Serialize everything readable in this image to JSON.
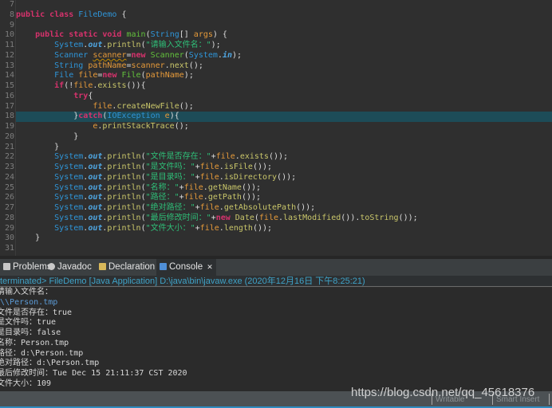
{
  "editor": {
    "lines": [
      {
        "num": "7",
        "tokens": []
      },
      {
        "num": "8",
        "tokens": [
          {
            "t": "k",
            "c": "public class "
          },
          {
            "t": "c",
            "c": "FileDemo"
          },
          {
            "t": "p",
            "c": " {"
          }
        ]
      },
      {
        "num": "9",
        "tokens": []
      },
      {
        "num": "10",
        "tokens": [
          {
            "t": "k",
            "c": "    public static void "
          },
          {
            "t": "fn",
            "c": "main"
          },
          {
            "t": "p",
            "c": "("
          },
          {
            "t": "c",
            "c": "String"
          },
          {
            "t": "p",
            "c": "[] "
          },
          {
            "t": "v",
            "c": "args"
          },
          {
            "t": "p",
            "c": ") {"
          }
        ]
      },
      {
        "num": "11",
        "tokens": [
          {
            "t": "c",
            "c": "        System"
          },
          {
            "t": "p",
            "c": "."
          },
          {
            "t": "f",
            "c": "out"
          },
          {
            "t": "p",
            "c": "."
          },
          {
            "t": "m",
            "c": "println"
          },
          {
            "t": "p",
            "c": "("
          },
          {
            "t": "s",
            "c": "\"请输入文件名：\""
          },
          {
            "t": "p",
            "c": ");"
          }
        ]
      },
      {
        "num": "12",
        "tokens": [
          {
            "t": "c",
            "c": "        Scanner "
          },
          {
            "t": "u",
            "c": "scanner"
          },
          {
            "t": "p",
            "c": "="
          },
          {
            "t": "k",
            "c": "new "
          },
          {
            "t": "fn",
            "c": "Scanner"
          },
          {
            "t": "p",
            "c": "("
          },
          {
            "t": "c",
            "c": "System"
          },
          {
            "t": "p",
            "c": "."
          },
          {
            "t": "f",
            "c": "in"
          },
          {
            "t": "p",
            "c": ");"
          }
        ]
      },
      {
        "num": "13",
        "tokens": [
          {
            "t": "c",
            "c": "        String "
          },
          {
            "t": "v",
            "c": "pathName"
          },
          {
            "t": "p",
            "c": "="
          },
          {
            "t": "v",
            "c": "scanner"
          },
          {
            "t": "p",
            "c": "."
          },
          {
            "t": "m",
            "c": "next"
          },
          {
            "t": "p",
            "c": "();"
          }
        ]
      },
      {
        "num": "14",
        "tokens": [
          {
            "t": "c",
            "c": "        File "
          },
          {
            "t": "v",
            "c": "file"
          },
          {
            "t": "p",
            "c": "="
          },
          {
            "t": "k",
            "c": "new "
          },
          {
            "t": "fn",
            "c": "File"
          },
          {
            "t": "p",
            "c": "("
          },
          {
            "t": "v",
            "c": "pathName"
          },
          {
            "t": "p",
            "c": ");"
          }
        ]
      },
      {
        "num": "15",
        "tokens": [
          {
            "t": "k",
            "c": "        if"
          },
          {
            "t": "p",
            "c": "(!"
          },
          {
            "t": "v",
            "c": "file"
          },
          {
            "t": "p",
            "c": "."
          },
          {
            "t": "m",
            "c": "exists"
          },
          {
            "t": "p",
            "c": "()){"
          }
        ]
      },
      {
        "num": "16",
        "tokens": [
          {
            "t": "k",
            "c": "            try"
          },
          {
            "t": "p",
            "c": "{"
          }
        ]
      },
      {
        "num": "17",
        "tokens": [
          {
            "t": "v",
            "c": "                file"
          },
          {
            "t": "p",
            "c": "."
          },
          {
            "t": "m",
            "c": "createNewFile"
          },
          {
            "t": "p",
            "c": "();"
          }
        ]
      },
      {
        "num": "18",
        "hl": true,
        "tokens": [
          {
            "t": "p",
            "c": "            }"
          },
          {
            "t": "k",
            "c": "catch"
          },
          {
            "t": "p",
            "c": "("
          },
          {
            "t": "c",
            "c": "IOException "
          },
          {
            "t": "v",
            "c": "e"
          },
          {
            "t": "p",
            "c": "){"
          }
        ]
      },
      {
        "num": "19",
        "tokens": [
          {
            "t": "v",
            "c": "                e"
          },
          {
            "t": "p",
            "c": "."
          },
          {
            "t": "m",
            "c": "printStackTrace"
          },
          {
            "t": "p",
            "c": "();"
          }
        ]
      },
      {
        "num": "20",
        "tokens": [
          {
            "t": "p",
            "c": "            }"
          }
        ]
      },
      {
        "num": "21",
        "tokens": [
          {
            "t": "p",
            "c": "        }"
          }
        ]
      },
      {
        "num": "22",
        "tokens": [
          {
            "t": "c",
            "c": "        System"
          },
          {
            "t": "p",
            "c": "."
          },
          {
            "t": "f",
            "c": "out"
          },
          {
            "t": "p",
            "c": "."
          },
          {
            "t": "m",
            "c": "println"
          },
          {
            "t": "p",
            "c": "("
          },
          {
            "t": "s",
            "c": "\"文件是否存在：\""
          },
          {
            "t": "p",
            "c": "+"
          },
          {
            "t": "v",
            "c": "file"
          },
          {
            "t": "p",
            "c": "."
          },
          {
            "t": "m",
            "c": "exists"
          },
          {
            "t": "p",
            "c": "());"
          }
        ]
      },
      {
        "num": "23",
        "tokens": [
          {
            "t": "c",
            "c": "        System"
          },
          {
            "t": "p",
            "c": "."
          },
          {
            "t": "f",
            "c": "out"
          },
          {
            "t": "p",
            "c": "."
          },
          {
            "t": "m",
            "c": "println"
          },
          {
            "t": "p",
            "c": "("
          },
          {
            "t": "s",
            "c": "\"是文件吗：\""
          },
          {
            "t": "p",
            "c": "+"
          },
          {
            "t": "v",
            "c": "file"
          },
          {
            "t": "p",
            "c": "."
          },
          {
            "t": "m",
            "c": "isFile"
          },
          {
            "t": "p",
            "c": "());"
          }
        ]
      },
      {
        "num": "24",
        "tokens": [
          {
            "t": "c",
            "c": "        System"
          },
          {
            "t": "p",
            "c": "."
          },
          {
            "t": "f",
            "c": "out"
          },
          {
            "t": "p",
            "c": "."
          },
          {
            "t": "m",
            "c": "println"
          },
          {
            "t": "p",
            "c": "("
          },
          {
            "t": "s",
            "c": "\"是目录吗：\""
          },
          {
            "t": "p",
            "c": "+"
          },
          {
            "t": "v",
            "c": "file"
          },
          {
            "t": "p",
            "c": "."
          },
          {
            "t": "m",
            "c": "isDirectory"
          },
          {
            "t": "p",
            "c": "());"
          }
        ]
      },
      {
        "num": "25",
        "tokens": [
          {
            "t": "c",
            "c": "        System"
          },
          {
            "t": "p",
            "c": "."
          },
          {
            "t": "f",
            "c": "out"
          },
          {
            "t": "p",
            "c": "."
          },
          {
            "t": "m",
            "c": "println"
          },
          {
            "t": "p",
            "c": "("
          },
          {
            "t": "s",
            "c": "\"名称：\""
          },
          {
            "t": "p",
            "c": "+"
          },
          {
            "t": "v",
            "c": "file"
          },
          {
            "t": "p",
            "c": "."
          },
          {
            "t": "m",
            "c": "getName"
          },
          {
            "t": "p",
            "c": "());"
          }
        ]
      },
      {
        "num": "26",
        "tokens": [
          {
            "t": "c",
            "c": "        System"
          },
          {
            "t": "p",
            "c": "."
          },
          {
            "t": "f",
            "c": "out"
          },
          {
            "t": "p",
            "c": "."
          },
          {
            "t": "m",
            "c": "println"
          },
          {
            "t": "p",
            "c": "("
          },
          {
            "t": "s",
            "c": "\"路径：\""
          },
          {
            "t": "p",
            "c": "+"
          },
          {
            "t": "v",
            "c": "file"
          },
          {
            "t": "p",
            "c": "."
          },
          {
            "t": "m",
            "c": "getPath"
          },
          {
            "t": "p",
            "c": "());"
          }
        ]
      },
      {
        "num": "27",
        "tokens": [
          {
            "t": "c",
            "c": "        System"
          },
          {
            "t": "p",
            "c": "."
          },
          {
            "t": "f",
            "c": "out"
          },
          {
            "t": "p",
            "c": "."
          },
          {
            "t": "m",
            "c": "println"
          },
          {
            "t": "p",
            "c": "("
          },
          {
            "t": "s",
            "c": "\"绝对路径：\""
          },
          {
            "t": "p",
            "c": "+"
          },
          {
            "t": "v",
            "c": "file"
          },
          {
            "t": "p",
            "c": "."
          },
          {
            "t": "m",
            "c": "getAbsolutePath"
          },
          {
            "t": "p",
            "c": "());"
          }
        ]
      },
      {
        "num": "28",
        "tokens": [
          {
            "t": "c",
            "c": "        System"
          },
          {
            "t": "p",
            "c": "."
          },
          {
            "t": "f",
            "c": "out"
          },
          {
            "t": "p",
            "c": "."
          },
          {
            "t": "m",
            "c": "println"
          },
          {
            "t": "p",
            "c": "("
          },
          {
            "t": "s",
            "c": "\"最后修改时间：\""
          },
          {
            "t": "p",
            "c": "+"
          },
          {
            "t": "k",
            "c": "new "
          },
          {
            "t": "m",
            "c": "Date"
          },
          {
            "t": "p",
            "c": "("
          },
          {
            "t": "v",
            "c": "file"
          },
          {
            "t": "p",
            "c": "."
          },
          {
            "t": "m",
            "c": "lastModified"
          },
          {
            "t": "p",
            "c": "())."
          },
          {
            "t": "m",
            "c": "toString"
          },
          {
            "t": "p",
            "c": "());"
          }
        ]
      },
      {
        "num": "29",
        "tokens": [
          {
            "t": "c",
            "c": "        System"
          },
          {
            "t": "p",
            "c": "."
          },
          {
            "t": "f",
            "c": "out"
          },
          {
            "t": "p",
            "c": "."
          },
          {
            "t": "m",
            "c": "println"
          },
          {
            "t": "p",
            "c": "("
          },
          {
            "t": "s",
            "c": "\"文件大小：\""
          },
          {
            "t": "p",
            "c": "+"
          },
          {
            "t": "v",
            "c": "file"
          },
          {
            "t": "p",
            "c": "."
          },
          {
            "t": "m",
            "c": "length"
          },
          {
            "t": "p",
            "c": "());"
          }
        ]
      },
      {
        "num": "30",
        "tokens": [
          {
            "t": "p",
            "c": "    }"
          }
        ]
      },
      {
        "num": "31",
        "tokens": []
      }
    ]
  },
  "views": {
    "tabs": [
      {
        "label": "Problems",
        "icon": "problems-icon",
        "color": "#c8c8c8"
      },
      {
        "label": "Javadoc",
        "icon": "javadoc-icon",
        "color": "#c8c8c8"
      },
      {
        "label": "Declaration",
        "icon": "declaration-icon",
        "color": "#d8b85a"
      },
      {
        "label": "Console",
        "icon": "console-icon",
        "color": "#4f8fd8",
        "active": true
      }
    ],
    "close_glyph": "✕"
  },
  "console": {
    "status": "terminated> FileDemo [Java Application] D:\\java\\bin\\javaw.exe (2020年12月16日 下午8:25:21)",
    "output": [
      {
        "text": "请输入文件名："
      },
      {
        "text": ":\\\\Person.tmp",
        "input": true
      },
      {
        "text": "文件是否存在：true"
      },
      {
        "text": "是文件吗：true"
      },
      {
        "text": "是目录吗：false"
      },
      {
        "text": "名称：Person.tmp"
      },
      {
        "text": "路径：d:\\Person.tmp"
      },
      {
        "text": "绝对路径：d:\\Person.tmp"
      },
      {
        "text": "最后修改时间：Tue Dec 15 21:11:37 CST 2020"
      },
      {
        "text": "文件大小：109"
      }
    ]
  },
  "statusbar": {
    "writable": "Writable",
    "insert_mode": "Smart Insert"
  },
  "watermark": "https://blog.csdn.net/qq_45618376"
}
